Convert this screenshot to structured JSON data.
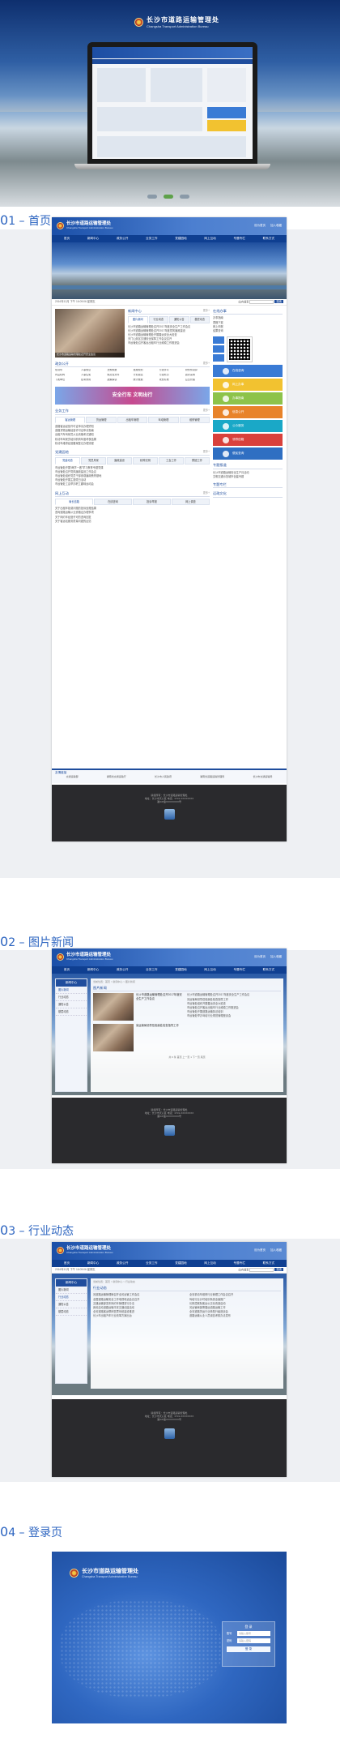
{
  "hero": {
    "title": "长沙市道路运输管理处",
    "subtitle": "Changsha Transport Administration Bureau"
  },
  "sections": [
    {
      "num": "0",
      "label": "1 – 首页"
    },
    {
      "num": "0",
      "label": "2 – 图片新闻"
    },
    {
      "num": "0",
      "label": "3 – 行业动态"
    },
    {
      "num": "0",
      "label": "4 – 登录页"
    }
  ],
  "site": {
    "name": "长沙市道路运输管理处",
    "name_en": "Changsha Transport Administration Bureau",
    "top_links": [
      "设为首页",
      "加入收藏"
    ],
    "nav": [
      "首页",
      "新闻中心",
      "政务公开",
      "业务工作",
      "党建园地",
      "网上互动",
      "专题专栏",
      "联系方式"
    ],
    "date": "2016年12月   下午 16:09:06   星期五",
    "search_label": "站内搜索",
    "search_button": "搜索"
  },
  "home": {
    "news_title": "新闻中心",
    "news_tabs": [
      "图片新闻",
      "行业动态",
      "通知公告",
      "基层动态"
    ],
    "news_items": [
      "长沙市道路运输管理处召开2017年度安全生产工作会议",
      "长沙市道路运输管理处召开2017年度党风廉政建设",
      "长沙市道路运输管理处开展春运安全大检查",
      "天门山景区交通安全保障工作会议召开",
      "市运管处召开客运出租车行业维稳工作推进会"
    ],
    "photo_caption": "长沙市道路运输管理处召开安全会议",
    "gov_title": "政务公开",
    "gov_tabs": [
      "机构",
      "人事",
      "法规",
      "规划",
      "财务",
      "统计",
      "公告",
      "其他"
    ],
    "gov_items": [
      "处领导",
      "人事信息",
      "法规规章",
      "发展规划",
      "行政许可",
      "财务预决算",
      "内设机构",
      "人事任免",
      "规范性文件",
      "计划总结",
      "行政处罚",
      "政府采购",
      "下属单位",
      "招考录用",
      "政策解读",
      "统计数据",
      "收费标准",
      "应急管理"
    ],
    "ad_text": "安全行车 文明出行",
    "business_title": "业务工作",
    "business_tabs": [
      "客运管理",
      "货运管理",
      "出租车管理",
      "驾培管理",
      "维修管理"
    ],
    "business_items": [
      "道路客运经营许可证申请办理须知",
      "道路货物运输经营许可证申请指南",
      "出租汽车驾驶员从业资格考试通知",
      "机动车驾驶员培训机构年度考核结果",
      "机动车维修经营备案登记办理流程"
    ],
    "party_title": "党建园地",
    "party_tabs": [
      "党建动态",
      "党员风采",
      "廉政建设",
      "精神文明",
      "工会工作",
      "群团工作"
    ],
    "party_items": [
      "市运管处开展“两学一做”学习教育专题党课",
      "市运管处召开党风廉政建设工作会议",
      "市运管处组织党员干部参观廉政教育基地",
      "市运管处开展主题党日活动",
      "市运管处工会举办职工趣味运动会"
    ],
    "interact_title": "网上互动",
    "interact_tabs": [
      "局长信箱",
      "在线咨询",
      "投诉举报",
      "网上调查"
    ],
    "interact_items": [
      "关于出租车拒载问题的投诉处理结果",
      "咨询道路运输从业资格证办理事项",
      "关于网约车经营许可的咨询回复",
      "关于客运站服务质量问题的反馈"
    ],
    "special_title": "专题专栏",
    "culture_title": "运政文化",
    "right_online": "在线办事",
    "right_links": [
      "办事指南",
      "表格下载",
      "网上申报",
      "结果查询"
    ],
    "tiles": [
      {
        "label": "在线咨询",
        "color": "#3a7bd5"
      },
      {
        "label": "网上办事",
        "color": "#f2c230"
      },
      {
        "label": "办事指南",
        "color": "#8dc34a"
      },
      {
        "label": "信息公开",
        "color": "#e8832a"
      },
      {
        "label": "公众服务",
        "color": "#1aa8c7"
      },
      {
        "label": "领导信箱",
        "color": "#d9413b"
      },
      {
        "label": "便民查询",
        "color": "#2f6fc2"
      }
    ],
    "notice_title": "专题报道",
    "notice_items": [
      "长沙市道路运输安全生产月活动",
      "文明交通示范城市创建专题"
    ],
    "links_title": "友情链接",
    "links": [
      "交通运输部",
      "湖南省交通运输厅",
      "长沙市人民政府",
      "湖南省道路运输管理局",
      "长沙市交通运输局"
    ],
    "footer_lines": [
      "版权所有：长沙市道路运输管理处",
      "地址：长沙市天心区  电话：0731-XXXXXXXX",
      "湘ICP备XXXXXXXX号"
    ]
  },
  "pic_news": {
    "sidebar_title": "新闻中心",
    "sidebar_items": [
      "图片新闻",
      "行业动态",
      "通知公告",
      "基层动态"
    ],
    "breadcrumb": "当前位置：首页 > 新闻中心 > 图片新闻",
    "list_title": "图片新闻",
    "featured": [
      {
        "title": "长沙市道路运输管理处召开2017年度安全生产工作会议"
      },
      {
        "title": "省运管局领导莅临我处检查指导工作"
      }
    ],
    "items": [
      "长沙市道路运输管理处召开2017年度安全生产工作会议",
      "省运管局领导莅临我处检查指导工作",
      "市运管处组织开展春运安全大检查",
      "市运管处召开客运出租车行业维稳工作推进会",
      "市运管处开展道路运输执法培训",
      "市运管处举办驾培行业规范管理座谈会"
    ],
    "pagination": "共 6 条  首页  上一页  1  下一页  尾页"
  },
  "industry": {
    "sidebar_title": "新闻中心",
    "sidebar_items": [
      "图片新闻",
      "行业动态",
      "通知公告",
      "基层动态"
    ],
    "breadcrumb": "当前位置：首页 > 新闻中心 > 行业动态",
    "list_title": "行业动态",
    "items_left": [
      "省道路运输管理局召开全省运管工作会议",
      "全国道路运输安全工作电视电话会议召开",
      "交通运输部发布网约车管理暂行办法",
      "我省启动道路运输平安交通创建活动",
      "全省道路客运联网售票系统建设推进",
      "长沙市出租汽车行业改革方案出台"
    ],
    "items_right": [
      "全省机动车维修行业管理工作会议召开",
      "驾培行业计时培训系统全面推广",
      "长株潭城际客运公交化改造启动",
      "省运管局部署春运道路运输工作",
      "全省道路货运行业转型升级座谈会",
      "道路运输从业人员诚信考核办法发布"
    ]
  },
  "login": {
    "title": "长沙市道路运输管理处",
    "subtitle": "Changsha Transport Administrative Bureau",
    "box_title": "登  录",
    "user_label": "账号",
    "user_placeholder": "请输入账号",
    "pass_label": "密码",
    "pass_placeholder": "请输入密码",
    "submit": "登  录"
  }
}
